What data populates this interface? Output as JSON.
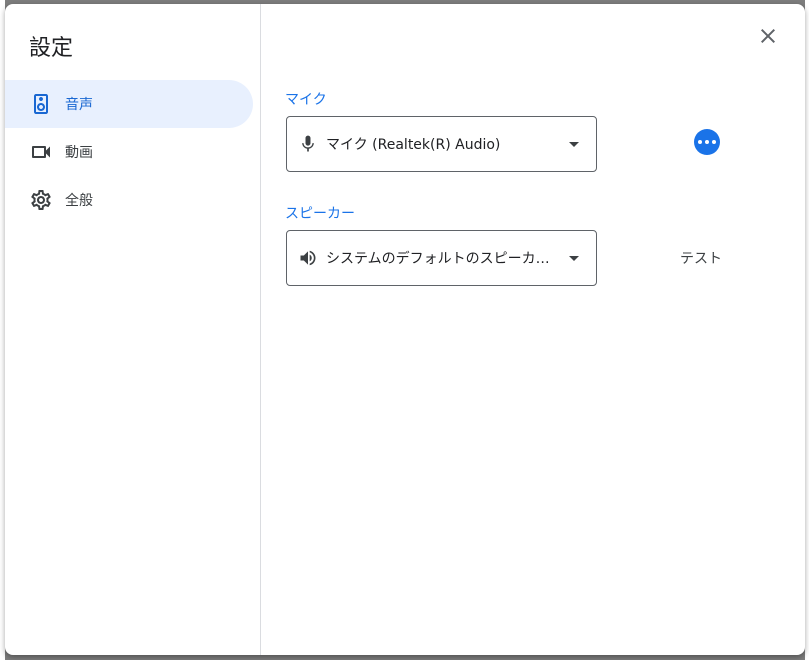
{
  "dialog": {
    "title": "設定",
    "close_icon": "close-icon"
  },
  "nav": {
    "items": [
      {
        "label": "音声",
        "icon": "speaker-icon",
        "active": true
      },
      {
        "label": "動画",
        "icon": "videocam-icon",
        "active": false
      },
      {
        "label": "全般",
        "icon": "gear-icon",
        "active": false
      }
    ]
  },
  "audio": {
    "mic": {
      "label": "マイク",
      "selected": "マイク (Realtek(R) Audio)",
      "icon": "mic-icon",
      "more_icon": "more-horiz-icon"
    },
    "speaker": {
      "label": "スピーカー",
      "selected": "システムのデフォルトのスピーカー (Realtek(R) Audio)",
      "icon": "volume-icon",
      "test_label": "テスト"
    }
  },
  "colors": {
    "accent": "#1a73e8",
    "active_nav_bg": "#e8f0fe",
    "overlay": "#7d7d7d"
  }
}
